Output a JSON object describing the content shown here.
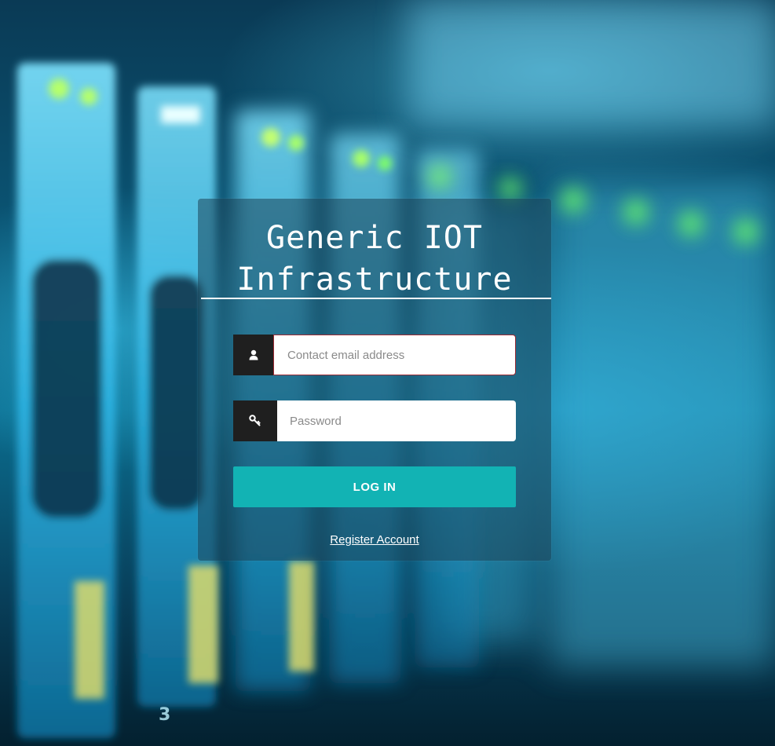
{
  "page": {
    "title_line1": "Generic IOT",
    "title_line2": "Infrastructure"
  },
  "login_form": {
    "email_placeholder": "Contact email address",
    "email_icon": "user-icon",
    "password_placeholder": "Password",
    "password_icon": "key-icon",
    "login_button_label": "LOG IN",
    "register_link_label": "Register Account"
  },
  "colors": {
    "accent": "#12b3b4",
    "icon_bg": "#1f1f1f",
    "email_border": "#9c2a33"
  }
}
